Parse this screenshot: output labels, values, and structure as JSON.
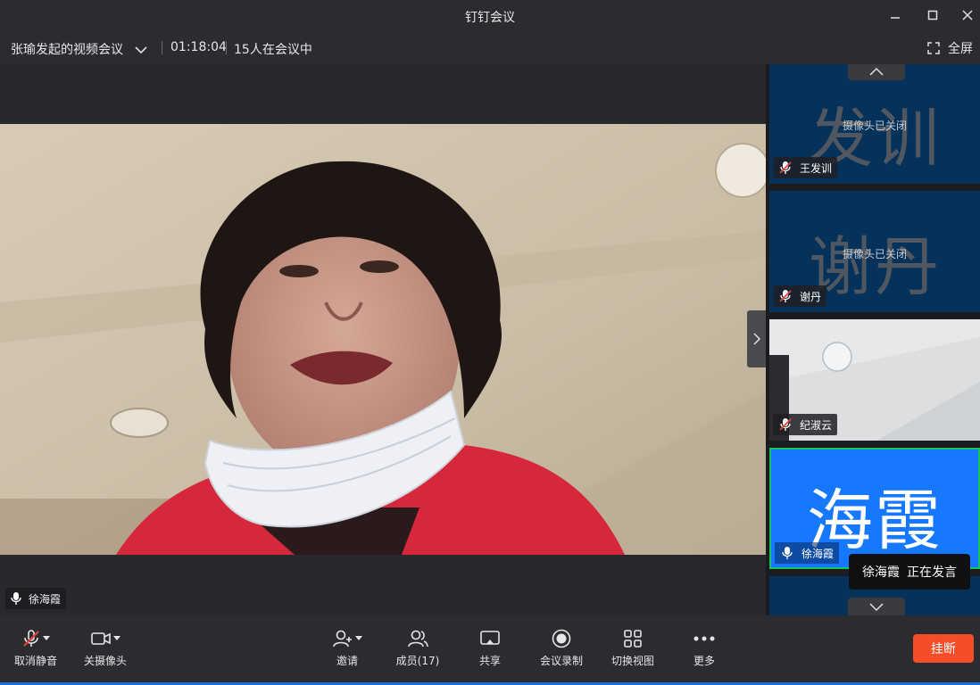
{
  "window": {
    "title": "钉钉会议"
  },
  "info": {
    "meeting_name": "张瑜发起的视频会议",
    "duration": "01:18:04",
    "participants_status": "15人在会议中",
    "fullscreen_label": "全屏"
  },
  "main_video": {
    "speaker_name": "徐海霞"
  },
  "sidebar": {
    "tiles": [
      {
        "avatar_text": "发训",
        "camera_status": "摄像头已关闭",
        "name": "王发训"
      },
      {
        "avatar_text": "谢丹",
        "camera_status": "摄像头已关闭",
        "name": "谢丹"
      },
      {
        "name": "纪淑云"
      },
      {
        "avatar_text": "海霞",
        "name": "徐海霞"
      }
    ]
  },
  "speaking_toast": {
    "name": "徐海霞",
    "status": "正在发言"
  },
  "toolbar": {
    "unmute_label": "取消静音",
    "camera_off_label": "关摄像头",
    "invite_label": "邀请",
    "members_label": "成员(17)",
    "share_label": "共享",
    "record_label": "会议录制",
    "switch_view_label": "切换视图",
    "more_label": "更多",
    "hangup_label": "挂断"
  },
  "colors": {
    "hangup": "#f54d28",
    "active_tile": "#1677ff",
    "active_border": "#17c45a",
    "tile_dark": "#04325a",
    "muted_red": "#e8413b"
  }
}
